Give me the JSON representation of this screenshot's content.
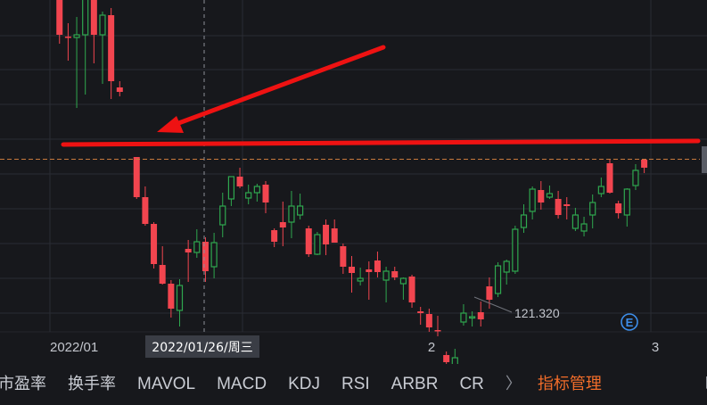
{
  "chart_data": {
    "type": "candlestick",
    "colors": {
      "up": "#2fa84f",
      "down": "#f2454f",
      "annotation": "#ee1212",
      "grid": "#2a2c33",
      "crosshair_label_bg": "#3a3d45",
      "axis_text": "#c3c6cd",
      "event_badge": "#3d8eea",
      "price_line": "#c87a3d"
    },
    "candles": [
      [
        162.6,
        167.2,
        160.6,
        165.6
      ],
      [
        165.0,
        166.0,
        158.5,
        159.2
      ],
      [
        159.6,
        162.6,
        158.0,
        162.0
      ],
      [
        162.0,
        165.8,
        161.0,
        164.5
      ],
      [
        164.2,
        165.0,
        156.8,
        157.3
      ],
      [
        157.0,
        158.2,
        151.2,
        152.2
      ],
      [
        152.0,
        153.5,
        149.3,
        151.9
      ],
      [
        151.9,
        154.2,
        144.0,
        152.2
      ],
      [
        152.2,
        158.2,
        145.5,
        156.2
      ],
      [
        156.2,
        156.5,
        149.0,
        152.2
      ],
      [
        152.2,
        154.8,
        146.7,
        154.4
      ],
      [
        154.4,
        155.2,
        145.0,
        147.0
      ],
      [
        146.3,
        147.0,
        145.3,
        145.8
      ],
      [
        138.5,
        138.5,
        133.8,
        134.0
      ],
      [
        134.0,
        135.2,
        130.8,
        131.0
      ],
      [
        131.0,
        131.2,
        126.0,
        126.5
      ],
      [
        126.4,
        128.5,
        124.2,
        124.3
      ],
      [
        124.3,
        124.7,
        120.5,
        121.5
      ],
      [
        121.3,
        124.8,
        119.5,
        124.1
      ],
      [
        128.2,
        129.2,
        124.5,
        127.8
      ],
      [
        127.8,
        130.4,
        127.2,
        129.0
      ],
      [
        129.0,
        129.5,
        124.5,
        125.7
      ],
      [
        126.2,
        130.0,
        124.9,
        128.9
      ],
      [
        130.9,
        134.5,
        129.5,
        133.0
      ],
      [
        133.8,
        136.3,
        133.0,
        136.3
      ],
      [
        136.3,
        137.3,
        135.0,
        135.2
      ],
      [
        133.9,
        135.4,
        133.2,
        134.5
      ],
      [
        134.5,
        135.5,
        133.5,
        135.2
      ],
      [
        135.4,
        135.8,
        132.2,
        133.4
      ],
      [
        130.3,
        130.5,
        128.4,
        129.0
      ],
      [
        131.2,
        133.5,
        128.5,
        130.6
      ],
      [
        131.2,
        134.7,
        129.4,
        133.0
      ],
      [
        132.0,
        134.4,
        131.5,
        133.0
      ],
      [
        130.5,
        130.8,
        127.3,
        127.6
      ],
      [
        127.6,
        130.1,
        127.5,
        129.8
      ],
      [
        130.9,
        131.5,
        127.5,
        128.7
      ],
      [
        130.5,
        131.5,
        129.2,
        128.9
      ],
      [
        128.5,
        128.8,
        125.4,
        126.2
      ],
      [
        126.2,
        127.4,
        123.3,
        125.5
      ],
      [
        124.6,
        126.1,
        124.1,
        124.9
      ],
      [
        125.9,
        126.8,
        122.5,
        125.6
      ],
      [
        126.9,
        127.9,
        125.0,
        125.6
      ],
      [
        124.7,
        126.2,
        122.2,
        125.7
      ],
      [
        125.7,
        126.2,
        124.7,
        125.0
      ],
      [
        124.3,
        125.0,
        122.5,
        124.9
      ],
      [
        125.1,
        125.3,
        121.6,
        122.2
      ],
      [
        121.2,
        121.7,
        119.7,
        121.0
      ],
      [
        120.9,
        121.5,
        118.9,
        119.4
      ],
      [
        119.1,
        120.7,
        118.4,
        119.0
      ],
      [
        116.3,
        116.7,
        114.5,
        115.5
      ],
      [
        114.5,
        117.0,
        113.5,
        116.0
      ],
      [
        120.0,
        122.0,
        119.6,
        121.0
      ],
      [
        120.5,
        121.2,
        119.5,
        120.6
      ],
      [
        121.1,
        122.3,
        119.5,
        120.3
      ],
      [
        124.0,
        125.0,
        121.5,
        122.5
      ],
      [
        123.2,
        126.7,
        122.8,
        126.3
      ],
      [
        125.6,
        127.0,
        124.2,
        126.8
      ],
      [
        125.7,
        130.8,
        125.4,
        130.4
      ],
      [
        130.6,
        133.2,
        130.0,
        132.0
      ],
      [
        132.4,
        135.2,
        131.5,
        134.9
      ],
      [
        134.8,
        135.8,
        132.6,
        133.4
      ],
      [
        134.0,
        135.3,
        133.8,
        134.4
      ],
      [
        133.8,
        134.7,
        131.6,
        132.0
      ],
      [
        133.2,
        134.0,
        131.5,
        133.0
      ],
      [
        130.5,
        132.8,
        130.2,
        132.0
      ],
      [
        130.2,
        131.8,
        129.6,
        131.0
      ],
      [
        132.0,
        134.3,
        130.5,
        133.4
      ],
      [
        134.4,
        136.2,
        134.0,
        135.2
      ],
      [
        137.8,
        138.3,
        134.4,
        134.5
      ],
      [
        133.3,
        133.6,
        131.6,
        132.2
      ],
      [
        132.0,
        135.0,
        130.7,
        134.9
      ],
      [
        135.3,
        137.7,
        134.8,
        137.0
      ],
      [
        138.2,
        138.2,
        136.7,
        137.3
      ]
    ],
    "x_ticks": [
      "2022/01",
      "2",
      "3"
    ],
    "crosshair_label": "2022/01/26/周三",
    "low_annotation": "121.320",
    "event_badge": "E",
    "annotations": [
      "arrow",
      "resistance-line"
    ]
  },
  "indicator_tabs": [
    "市盈率",
    "换手率",
    "MAVOL",
    "MACD",
    "KDJ",
    "RSI",
    "ARBR",
    "CR"
  ],
  "more_chevron": "〉",
  "manage_tab": "指标管理",
  "cut_tab": "时"
}
